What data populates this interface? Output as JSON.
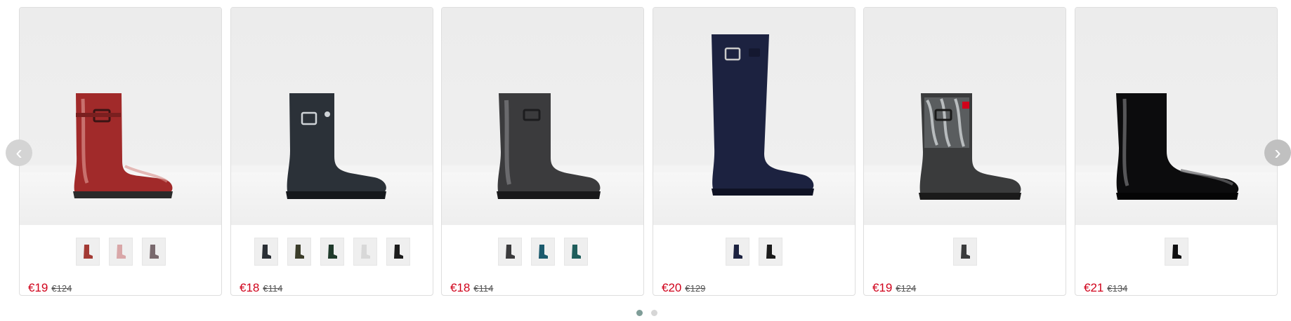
{
  "carousel": {
    "products": [
      {
        "name": "red-short-boot",
        "price": "€19",
        "old_price": "€124",
        "boot_color": "#a12a2a",
        "boot_type": "short-gloss",
        "swatches": [
          "#a33a34",
          "#d9a7a8",
          "#7a6a6e"
        ]
      },
      {
        "name": "navy-short-boot",
        "price": "€18",
        "old_price": "€114",
        "boot_color": "#2b3138",
        "boot_type": "short-matte",
        "swatches": [
          "#2a2f35",
          "#3b3d2a",
          "#1f3a2b",
          "#d8d8d8",
          "#1b1b1b"
        ]
      },
      {
        "name": "grey-gloss-short-boot",
        "price": "€18",
        "old_price": "€114",
        "boot_color": "#3b3b3d",
        "boot_type": "short-gloss",
        "swatches": [
          "#3a3a3c",
          "#1b5a6d",
          "#1f5e5c"
        ]
      },
      {
        "name": "navy-tall-boot",
        "price": "€20",
        "old_price": "€129",
        "boot_color": "#1c2240",
        "boot_type": "tall-matte",
        "swatches": [
          "#1c2240",
          "#1a1a1a"
        ]
      },
      {
        "name": "camo-short-boot",
        "price": "€19",
        "old_price": "€124",
        "boot_color": "#3a3b3c",
        "boot_type": "short-camo",
        "swatches": [
          "#3a3b3c"
        ]
      },
      {
        "name": "black-gloss-refined-boot",
        "price": "€21",
        "old_price": "€134",
        "boot_color": "#0c0c0d",
        "boot_type": "short-refined",
        "swatches": [
          "#0f0f10"
        ]
      }
    ],
    "prev_icon": "chevron-left-icon",
    "next_icon": "chevron-right-icon",
    "pages": 2,
    "active_page": 1
  }
}
